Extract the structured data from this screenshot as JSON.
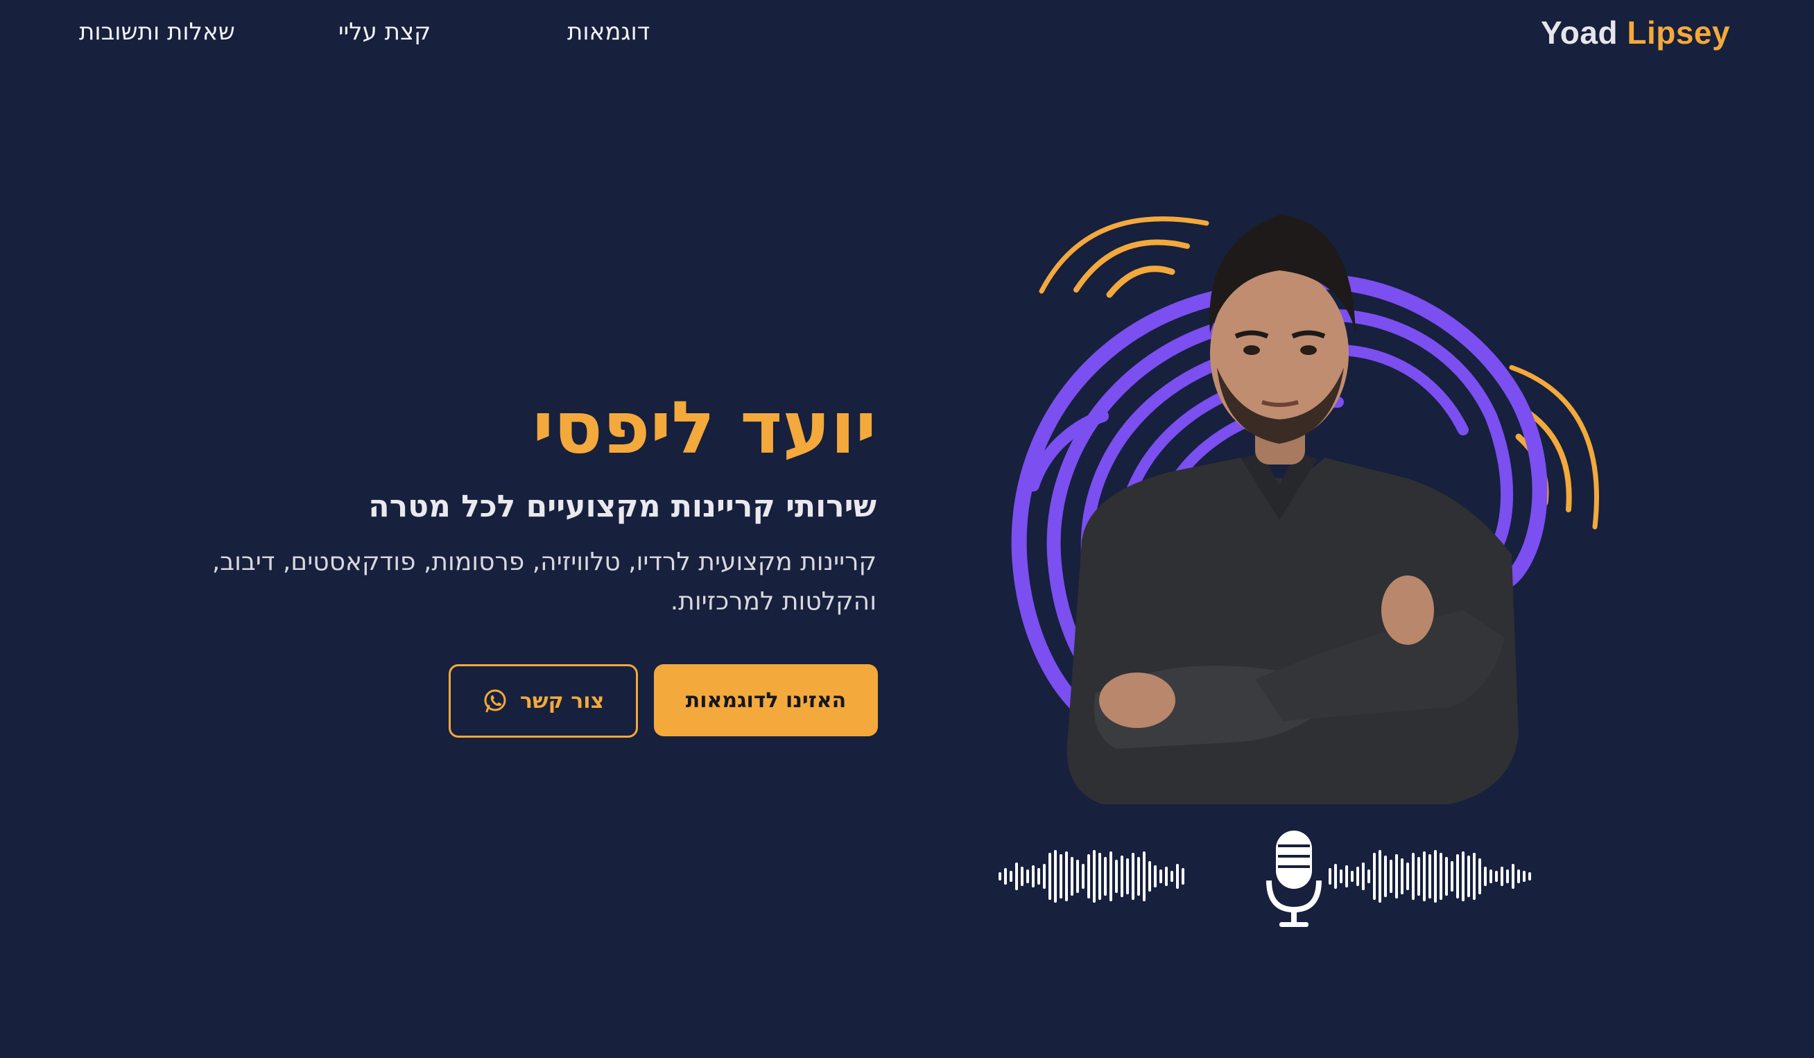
{
  "nav": {
    "logo_first": "Yoad",
    "logo_second": "Lipsey",
    "links": [
      "שאלות ותשובות",
      "קצת עליי",
      "דוגמאות"
    ]
  },
  "hero": {
    "title": "יועד ליפסי",
    "subtitle": "שירותי קריינות מקצועיים לכל מטרה",
    "description": "קריינות מקצועית לרדיו, טלוויזיה, פרסומות, פודקאסטים, דיבוב, והקלטות למרכזיות."
  },
  "buttons": {
    "primary": "האזינו לדוגמאות",
    "contact": "צור קשר"
  },
  "icons": {
    "contact_icon": "whatsapp-icon",
    "mic_icon": "microphone-icon"
  },
  "colors": {
    "background": "#17203d",
    "accent": "#f3a93b",
    "purple": "#7b4ff0",
    "text": "#ffffff"
  }
}
